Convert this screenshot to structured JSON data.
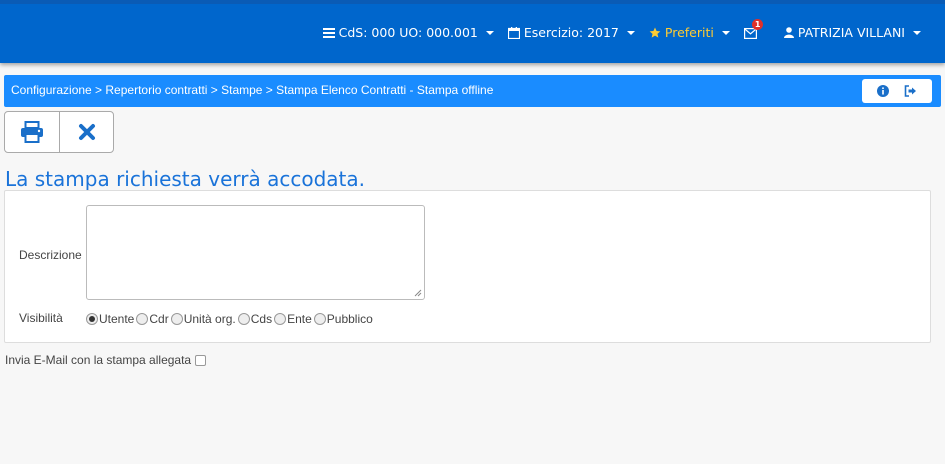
{
  "navbar": {
    "cds": "CdS: 000 UO: 000.001",
    "esercizio": "Esercizio: 2017",
    "preferiti": "Preferiti",
    "mail_badge": "1",
    "user": "PATRIZIA VILLANI"
  },
  "breadcrumb": {
    "text": "Configurazione > Repertorio contratti > Stampe > Stampa Elenco Contratti - Stampa offline"
  },
  "page": {
    "heading": "La stampa richiesta verrà accodata."
  },
  "form": {
    "descrizione_label": "Descrizione",
    "descrizione_value": "",
    "visibilita_label": "Visibilità",
    "visibilita_options": [
      "Utente",
      "Cdr",
      "Unità org.",
      "Cds",
      "Ente",
      "Pubblico"
    ],
    "visibilita_selected": "Utente",
    "email_label": "Invia E-Mail con la stampa allegata"
  },
  "colors": {
    "navbar": "#0066cc",
    "breadcrumb": "#1a8cff",
    "accent": "#1a73d9"
  }
}
